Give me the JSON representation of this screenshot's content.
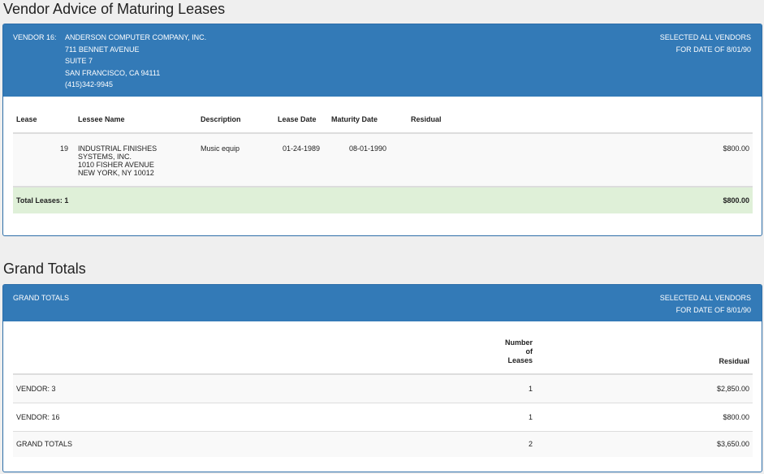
{
  "vendor_section": {
    "title": "Vendor Advice of Maturing Leases",
    "header": {
      "vendor_label": "VENDOR  16:",
      "address_lines": [
        "ANDERSON COMPUTER COMPANY, INC.",
        "711 BENNET AVENUE",
        "SUITE 7",
        "SAN FRANCISCO, CA 94111",
        "(415)342-9945"
      ],
      "selection": "SELECTED ALL VENDORS",
      "for_date": "FOR DATE OF 8/01/90"
    },
    "columns": {
      "lease": "Lease",
      "lessee_name": "Lessee Name",
      "description": "Description",
      "lease_date": "Lease Date",
      "maturity_date": "Maturity Date",
      "residual": "Residual"
    },
    "rows": [
      {
        "lease": "19",
        "lessee_lines": [
          "INDUSTRIAL FINISHES",
          "SYSTEMS, INC.",
          "1010 FISHER AVENUE",
          "NEW YORK, NY 10012"
        ],
        "description": "Music equip",
        "lease_date": "01-24-1989",
        "maturity_date": "08-01-1990",
        "residual": "$800.00"
      }
    ],
    "totals": {
      "label": "Total Leases: 1",
      "residual": "$800.00"
    }
  },
  "grand_section": {
    "title": "Grand Totals",
    "header": {
      "label": "GRAND TOTALS",
      "selection": "SELECTED ALL VENDORS",
      "for_date": "FOR DATE OF 8/01/90"
    },
    "columns": {
      "number_line1": "Number of",
      "number_line2": "Leases",
      "residual": "Residual"
    },
    "rows": [
      {
        "label": "VENDOR: 3",
        "count": "1",
        "residual": "$2,850.00"
      },
      {
        "label": "VENDOR: 16",
        "count": "1",
        "residual": "$800.00"
      },
      {
        "label": "GRAND TOTALS",
        "count": "2",
        "residual": "$3,650.00"
      }
    ]
  }
}
